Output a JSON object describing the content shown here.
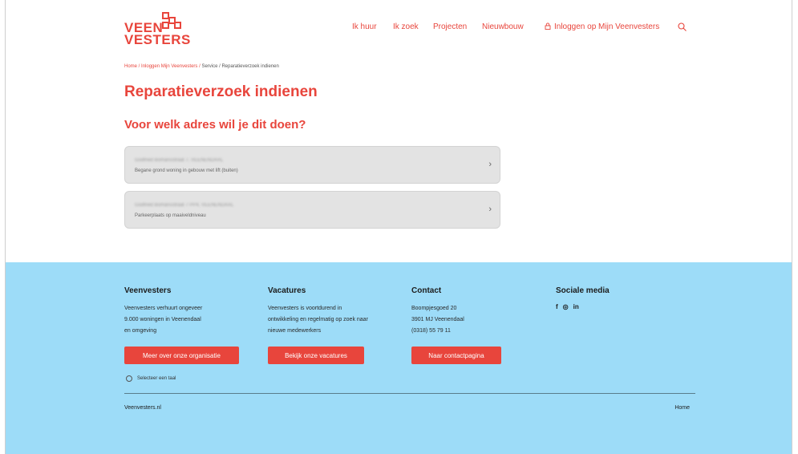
{
  "header": {
    "logo": {
      "line1": "VEEN",
      "line2": "VESTERS"
    },
    "nav": [
      "Ik huur",
      "Ik zoek",
      "Projecten",
      "Nieuwbouw"
    ],
    "login_label": "Inloggen op Mijn Veenvesters"
  },
  "breadcrumb": {
    "home": "Home",
    "login": "Inloggen Mijn Veenvesters",
    "service": "Service",
    "current": "Reparatieverzoek indienen",
    "sep": " / "
  },
  "page": {
    "title": "Reparatieverzoek indienen",
    "question": "Voor welk adres wil je dit doen?"
  },
  "addresses": [
    {
      "address": "Godfried Bomansstraat 7, VEENENDAAL",
      "description": "Begane grond woning in gebouw met lift (buiten)"
    },
    {
      "address": "Godfried Bomansstraat 7 PP4, VEENENDAAL",
      "description": "Parkeerplaats op maaiveldniveau"
    }
  ],
  "footer": {
    "col1": {
      "heading": "Veenvesters",
      "lines": [
        "Veenvesters verhuurt ongeveer",
        "9.000 woningen in Veenendaal",
        "en omgeving"
      ],
      "button": "Meer over onze organisatie"
    },
    "col2": {
      "heading": "Vacatures",
      "lines": [
        "Veenvesters is voortdurend in",
        "ontwikkeling en regelmatig op zoek naar",
        "nieuwe medewerkers"
      ],
      "button": "Bekijk onze vacatures"
    },
    "col3": {
      "heading": "Contact",
      "lines": [
        "Boompjesgoed 20",
        "3901 MJ  Veenendaal",
        "(0318) 55 79 11"
      ],
      "button": "Naar contactpagina"
    },
    "col4": {
      "heading": "Sociale media",
      "icons": [
        "f",
        "◎",
        "in"
      ]
    },
    "language": "Selecteer een taal",
    "site": "Veenvesters.nl",
    "home_link": "Home"
  },
  "colors": {
    "brand": "#e8453c",
    "footer_bg": "#9ddcf8"
  }
}
